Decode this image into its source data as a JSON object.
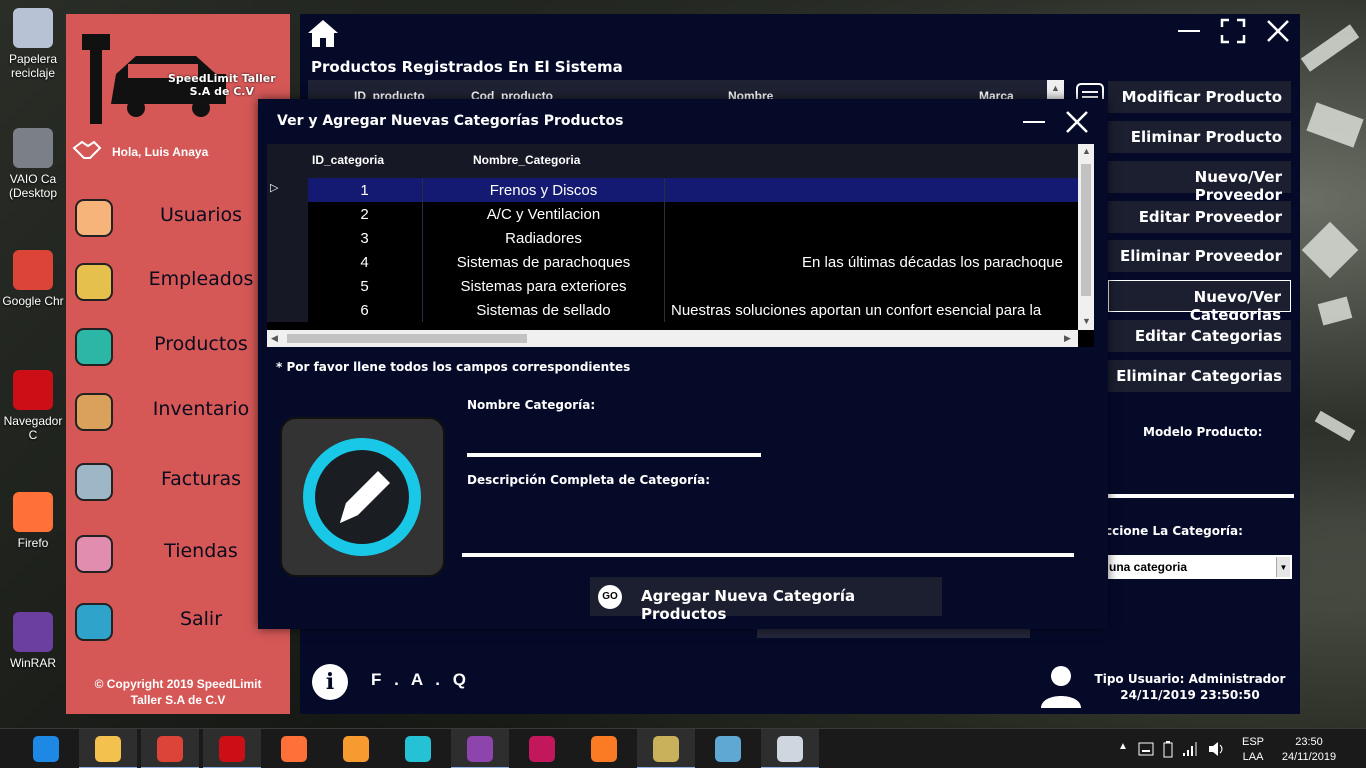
{
  "desktop": {
    "icons": [
      {
        "label": "Papelera de reciclaje",
        "short": "Papelera\nreciclaje",
        "icon": "recycle-bin-icon",
        "color": "#b7c3d4"
      },
      {
        "label": "VAIO Ca (Desktop)",
        "short": "VAIO Ca\n(Desktop",
        "icon": "laptop-icon",
        "color": "#7a7f88"
      },
      {
        "label": "Google Chrome",
        "short": "Google Chr",
        "icon": "chrome-icon",
        "color": "#db4437"
      },
      {
        "label": "Navegador Opera",
        "short": "Navegador C",
        "icon": "opera-icon",
        "color": "#cc0f16"
      },
      {
        "label": "Firefox",
        "short": "Firefo",
        "icon": "firefox-icon",
        "color": "#ff7139"
      },
      {
        "label": "WinRAR",
        "short": "WinRAR",
        "icon": "winrar-icon",
        "color": "#6b3fa0"
      }
    ]
  },
  "app": {
    "brand": "SpeedLimit Taller S.A de C.V",
    "brand_line1": "SpeedLimit Taller",
    "brand_line2": "S.A de C.V",
    "greeting": "Hola, Luis Anaya",
    "menu": [
      {
        "label": "Usuarios",
        "icon": "user-avatar-icon"
      },
      {
        "label": "Empleados",
        "icon": "employee-badge-icon"
      },
      {
        "label": "Productos",
        "icon": "shopping-basket-icon"
      },
      {
        "label": "Inventario",
        "icon": "box-icon"
      },
      {
        "label": "Facturas",
        "icon": "invoice-icon"
      },
      {
        "label": "Tiendas",
        "icon": "store-icon"
      },
      {
        "label": "Salir",
        "icon": "exit-icon"
      }
    ],
    "copyright_line1": "© Copyright 2019 SpeedLimit",
    "copyright_line2": "Taller S.A de C.V",
    "main_title": "Productos Registrados En El Sistema",
    "main_grid_headers": [
      "ID_producto",
      "Cod_producto",
      "Nombre",
      "Marca"
    ],
    "right_buttons": [
      {
        "label": "Modificar Producto",
        "active": false
      },
      {
        "label": "Eliminar Producto",
        "active": false
      },
      {
        "label": "Nuevo/Ver Proveedor",
        "active": false
      },
      {
        "label": "Editar Proveedor",
        "active": false
      },
      {
        "label": "Eliminar Proveedor",
        "active": false
      },
      {
        "label": "Nuevo/Ver Categorias",
        "active": true
      },
      {
        "label": "Editar Categorias",
        "active": false
      },
      {
        "label": "Eliminar Categorias",
        "active": false
      }
    ],
    "modelo_label": "Modelo Producto:",
    "categoria_label": "ccione La Categoría:",
    "categoria_combo_value": "una categoria",
    "faq_label": "F . A . Q",
    "user_type": "Tipo Usuario: Administrador",
    "datetime": "24/11/2019 23:50:50"
  },
  "dialog": {
    "title": "Ver y Agregar Nuevas Categorías Productos",
    "grid_headers": [
      "ID_categoria",
      "Nombre_Categoria"
    ],
    "rows": [
      {
        "id": "1",
        "name": "Frenos y Discos",
        "desc": ""
      },
      {
        "id": "2",
        "name": "A/C y Ventilacion",
        "desc": ""
      },
      {
        "id": "3",
        "name": "Radiadores",
        "desc": ""
      },
      {
        "id": "4",
        "name": "Sistemas de parachoques",
        "desc": "En las últimas décadas los parachoque"
      },
      {
        "id": "5",
        "name": "Sistemas para exteriores",
        "desc": ""
      },
      {
        "id": "6",
        "name": "Sistemas de sellado",
        "desc": "Nuestras soluciones aportan un confort esencial para la"
      }
    ],
    "note": "* Por favor llene todos los campos correspondientes",
    "nombre_label": "Nombre Categoría:",
    "nombre_value": "",
    "descripcion_label": "Descripción Completa de Categoría:",
    "descripcion_value": "",
    "go_label": "GO",
    "submit_label": "Agregar Nueva Categoría Productos"
  },
  "taskbar": {
    "apps": [
      {
        "name": "internet-explorer",
        "icon": "ie-icon",
        "color": "#1e88e5",
        "open": false
      },
      {
        "name": "file-explorer",
        "icon": "folder-icon",
        "color": "#f2c14e",
        "open": true
      },
      {
        "name": "chrome",
        "icon": "chrome-icon",
        "color": "#db4437",
        "open": true
      },
      {
        "name": "opera",
        "icon": "opera-icon",
        "color": "#cc0f16",
        "open": true
      },
      {
        "name": "firefox",
        "icon": "firefox-icon",
        "color": "#ff7139",
        "open": false
      },
      {
        "name": "sublime-text",
        "icon": "sublime-icon",
        "color": "#f79a2f",
        "open": false
      },
      {
        "name": "terminal-app",
        "icon": "arrow-app-icon",
        "color": "#25c2d6",
        "open": false
      },
      {
        "name": "visual-studio",
        "icon": "visual-studio-icon",
        "color": "#8e44ad",
        "open": true
      },
      {
        "name": "uwamp",
        "icon": "uwamp-icon",
        "color": "#c2185b",
        "open": false
      },
      {
        "name": "xampp",
        "icon": "xampp-icon",
        "color": "#fb7a24",
        "open": false
      },
      {
        "name": "tools-app",
        "icon": "tools-icon",
        "color": "#c8b15a",
        "open": true
      },
      {
        "name": "virtualbox",
        "icon": "cube-icon",
        "color": "#5fa8d3",
        "open": false
      },
      {
        "name": "speedlimit-app",
        "icon": "wrench-car-icon",
        "color": "#d0d6e0",
        "open": true
      }
    ],
    "lang_top": "ESP",
    "lang_bottom": "LAA",
    "time": "23:50",
    "date": "24/11/2019"
  }
}
